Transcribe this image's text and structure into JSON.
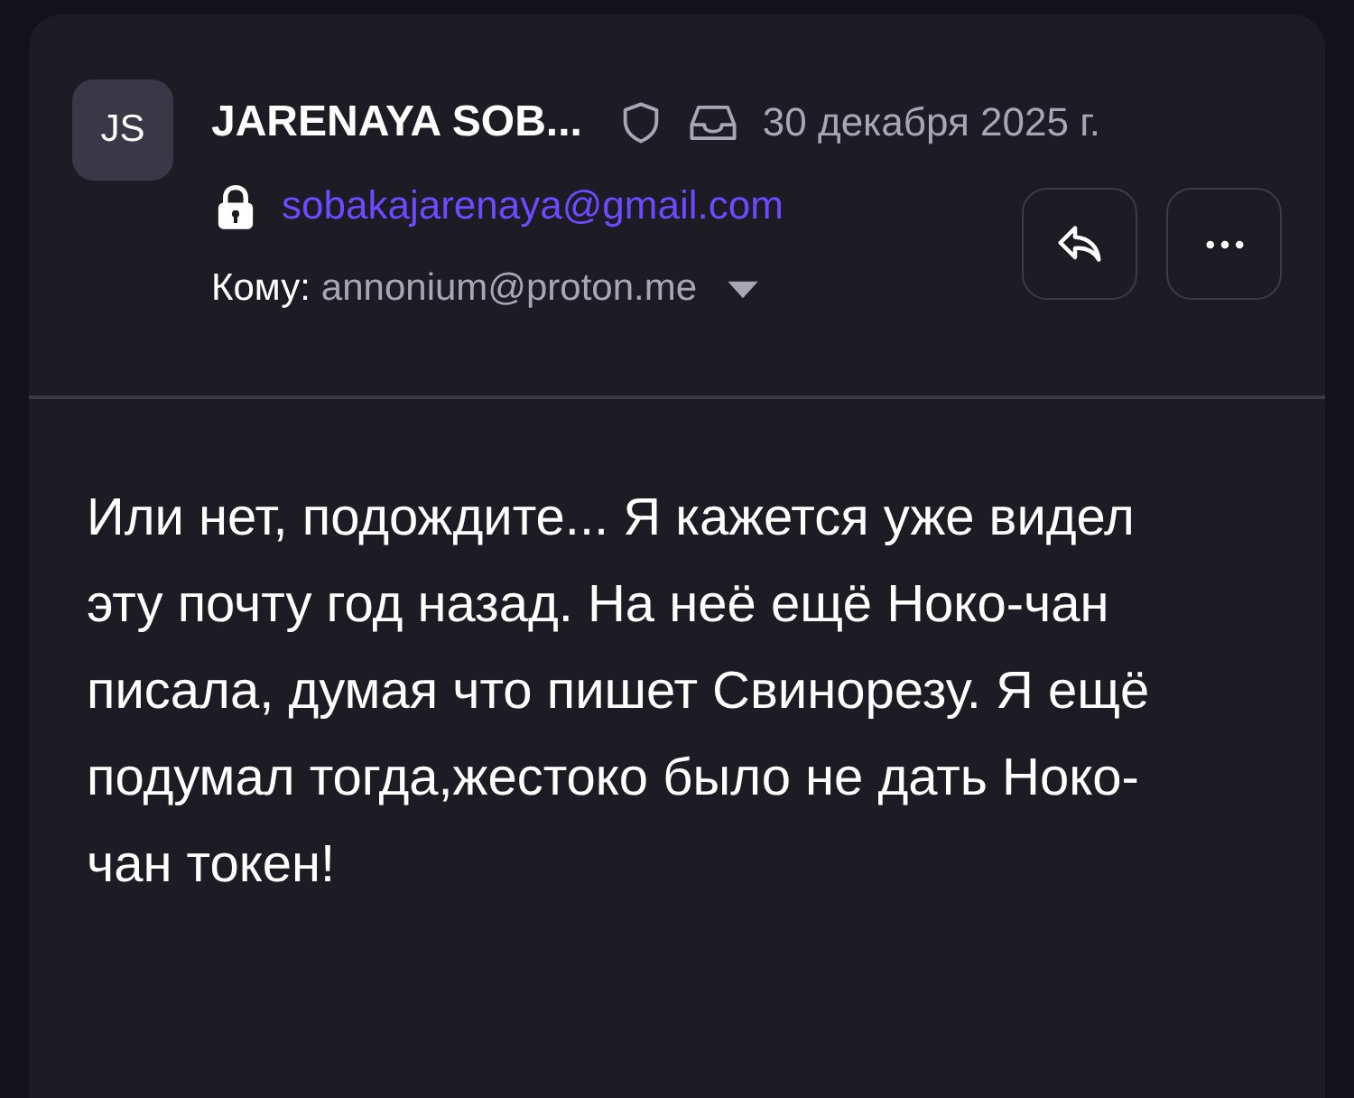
{
  "message": {
    "sender": {
      "initials": "JS",
      "name": "JARENAYA SOB...",
      "email": "sobakajarenaya@gmail.com"
    },
    "date": "30 декабря 2025 г.",
    "recipient": {
      "label": "Кому:",
      "address": "annonium@proton.me",
      "expanded": false
    },
    "body": "Или нет, подождите... Я кажется уже видел эту почту год назад. На неё ещё Ноко-чан писала, думая что пишет Свинорезу. Я ещё подумал тогда,жестоко было не дать Ноко-чан токен!"
  }
}
